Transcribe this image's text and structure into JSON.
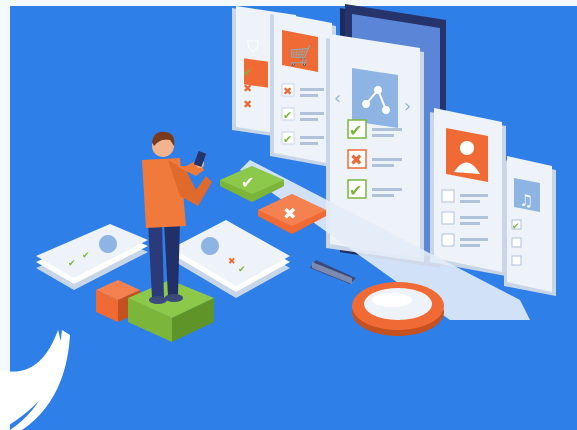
{
  "illustration": {
    "subject": "isometric-app-testing-checklist",
    "colors": {
      "background": "#2F7FE8",
      "background_light": "#3B8BF0",
      "card": "#EEF3FA",
      "card_shadow": "#C9D6E8",
      "accent_orange": "#F06A35",
      "accent_green": "#7BB63A",
      "accent_green_dark": "#5E9428",
      "icon_blue": "#8DB4E2",
      "phone_dark": "#27336B",
      "person_shirt": "#F07A3C",
      "person_pants": "#2A3A7A",
      "person_hair": "#7A3A1E",
      "skin": "#F2B48C",
      "white": "#FFFFFF"
    },
    "cards": [
      {
        "icon": "shield-icon",
        "marks": [
          "check",
          "cross",
          "check"
        ]
      },
      {
        "icon": "cart-icon",
        "marks": [
          "cross",
          "check",
          "check"
        ]
      },
      {
        "icon": "share-icon",
        "marks": [
          "check",
          "cross",
          "check"
        ]
      },
      {
        "icon": "user-icon",
        "marks": [
          "empty",
          "empty",
          "empty"
        ]
      },
      {
        "icon": "music-icon",
        "marks": [
          "check",
          "empty",
          "empty"
        ]
      }
    ],
    "floor_items": [
      "check-badge",
      "cross-badge",
      "magnifier",
      "paper-stack-left",
      "paper-stack-right",
      "orange-cube",
      "green-pedestal"
    ]
  }
}
